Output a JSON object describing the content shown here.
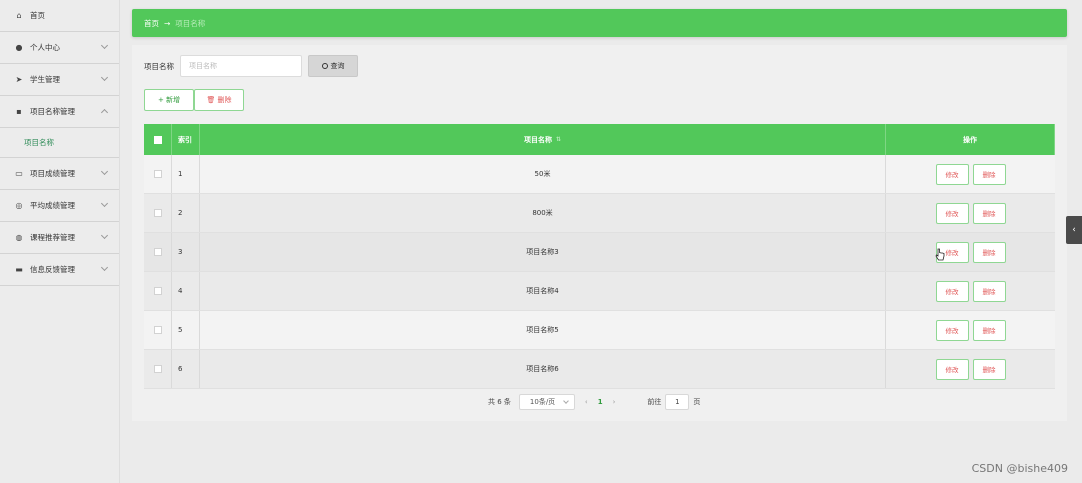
{
  "sidebar": {
    "items": [
      {
        "label": "首页",
        "icon": "home-icon",
        "glyph": "⌂"
      },
      {
        "label": "个人中心",
        "icon": "user-icon",
        "glyph": "●"
      },
      {
        "label": "学生管理",
        "icon": "send-icon",
        "glyph": "➤"
      },
      {
        "label": "项目名称管理",
        "icon": "trash-icon",
        "glyph": "▪"
      },
      {
        "label": "项目成绩管理",
        "icon": "card-icon",
        "glyph": "▭"
      },
      {
        "label": "平均成绩管理",
        "icon": "circle-icon",
        "glyph": "◎"
      },
      {
        "label": "课程推荐管理",
        "icon": "globe-icon",
        "glyph": "◍"
      },
      {
        "label": "信息反馈管理",
        "icon": "printer-icon",
        "glyph": "▬"
      }
    ],
    "submenu_label": "项目名称"
  },
  "breadcrumb": {
    "home": "首页",
    "arrow": "→",
    "current": "项目名称"
  },
  "search": {
    "label": "项目名称",
    "placeholder": "项目名称",
    "button_label": "查询"
  },
  "actions": {
    "add_label": "+ 新增",
    "delete_label": "🗑 删除"
  },
  "table": {
    "headers": {
      "index": "索引",
      "name": "项目名称",
      "op": "操作",
      "sort": "⇅"
    },
    "rows": [
      {
        "index": "1",
        "name": "50米"
      },
      {
        "index": "2",
        "name": "800米"
      },
      {
        "index": "3",
        "name": "项目名称3"
      },
      {
        "index": "4",
        "name": "项目名称4"
      },
      {
        "index": "5",
        "name": "项目名称5"
      },
      {
        "index": "6",
        "name": "项目名称6"
      }
    ],
    "edit_label": "修改",
    "delete_label": "删除"
  },
  "pagination": {
    "total": "共 6 条",
    "page_size": "10条/页",
    "prev": "‹",
    "current": "1",
    "next": "›",
    "goto_label": "前往",
    "goto_value": "1",
    "page_suffix": "页"
  },
  "side_tab": {
    "glyph": "‹"
  },
  "watermark": "CSDN @bishe409",
  "colors": {
    "accent": "#52c85a",
    "danger": "#e05555",
    "sidebar": "#ececec"
  }
}
